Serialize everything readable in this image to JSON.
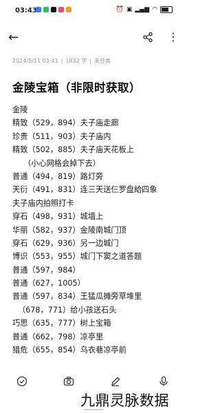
{
  "status_bar": {
    "time": "03:43",
    "battery": "100",
    "colors": {
      "app1": "#3d7ef5",
      "app2": "#2bbf6a",
      "app3": "#111111",
      "app4": "#e84a7a",
      "app5": "#f0a020"
    }
  },
  "toolbar": {
    "back_icon": "←",
    "more_icon": "⋮"
  },
  "meta": {
    "date": "2024/5/11 03:41",
    "word_count": "1832 字",
    "category": "未分类"
  },
  "title": "金陵宝箱（非限时获取）",
  "lines": [
    "金陵",
    "精致（529，894）夫子庙走廊",
    "珍贵（511，903）夫子庙内",
    "精致（502，885）夫子庙天花板上",
    "（小心网格会掉下去）",
    "普通（494，819）路灯旁",
    "天衍（491，831）连三天送仨罗盘給四象",
    "夫子庙内拍照打卡",
    "穿石（498，931）城墙上",
    "华丽（582，937）金陵南城门顶",
    "穿石（629，936）另一边城门",
    "博识（553，955）城门下窦之道答题",
    "普通（597，984）",
    "普通（627，1005）",
    "普通（597，834）王猛瓜摊旁草堆里",
    "（678，771）给小孩送石头",
    "巧思（635，777）树上宝箱",
    "普通（662，798）凉亭里",
    "猎危（655，854）乌衣巷凉亭前"
  ],
  "watermark": "九鼎灵脉数据"
}
